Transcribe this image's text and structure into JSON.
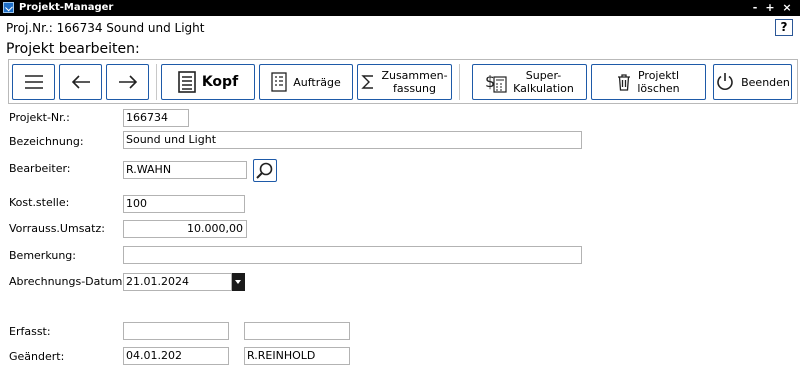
{
  "window": {
    "title": "Projekt-Manager",
    "controls": [
      "-",
      "+",
      "×"
    ]
  },
  "project_line": "Proj.Nr.: 166734 Sound und Light",
  "help_label": "?",
  "heading": "Projekt bearbeiten:",
  "toolbar": {
    "menu_icon": "hamburger-icon",
    "back_icon": "arrow-left-icon",
    "forward_icon": "arrow-right-icon",
    "kopf": "Kopf",
    "auftraege": "Aufträge",
    "zusammenfassung": "Zusammen-\nfassung",
    "superkalkulation": "Super-\nKalkulation",
    "loeschen": "Projektl\nlöschen",
    "beenden": "Beenden"
  },
  "form": {
    "projekt_nr": {
      "label": "Projekt-Nr.:",
      "value": "166734"
    },
    "bezeichnung": {
      "label": "Bezeichnung:",
      "value": "Sound und Light"
    },
    "bearbeiter": {
      "label": "Bearbeiter:",
      "value": "R.WAHN"
    },
    "kostenstelle": {
      "label": "Kost.stelle:",
      "value": "100"
    },
    "umsatz": {
      "label": "Vorrauss.Umsatz:",
      "value": "10.000,00"
    },
    "bemerkung": {
      "label": "Bemerkung:",
      "value": ""
    },
    "abrechnungsdatum": {
      "label": "Abrechnungs-Datum:",
      "value": "21.01.2024"
    },
    "erfasst": {
      "label": "Erfasst:",
      "value1": "",
      "value2": ""
    },
    "geaendert": {
      "label": "Geändert:",
      "value1": "04.01.202",
      "value2": "R.REINHOLD"
    }
  },
  "colors": {
    "accent": "#1e5aa8",
    "titlebar": "#000000"
  }
}
